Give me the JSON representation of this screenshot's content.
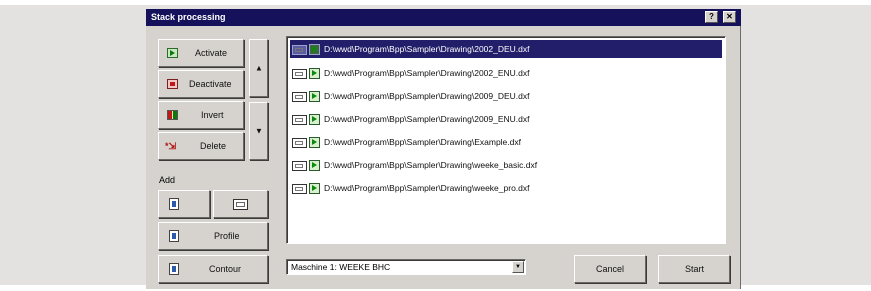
{
  "window": {
    "title": "Stack processing",
    "help_glyph": "?",
    "close_glyph": "✕"
  },
  "buttons": {
    "activate": "Activate",
    "deactivate": "Deactivate",
    "invert": "Invert",
    "delete": "Delete",
    "up_glyph": "▲",
    "down_glyph": "▼",
    "profile": "Profile",
    "contour": "Contour",
    "cancel": "Cancel",
    "start": "Start"
  },
  "add_section": {
    "label": "Add"
  },
  "file_list": {
    "items": [
      {
        "path": "D:\\wwd\\Program\\Bpp\\Sampler\\Drawing\\2002_DEU.dxf",
        "selected": true
      },
      {
        "path": "D:\\wwd\\Program\\Bpp\\Sampler\\Drawing\\2002_ENU.dxf",
        "selected": false
      },
      {
        "path": "D:\\wwd\\Program\\Bpp\\Sampler\\Drawing\\2009_DEU.dxf",
        "selected": false
      },
      {
        "path": "D:\\wwd\\Program\\Bpp\\Sampler\\Drawing\\2009_ENU.dxf",
        "selected": false
      },
      {
        "path": "D:\\wwd\\Program\\Bpp\\Sampler\\Drawing\\Example.dxf",
        "selected": false
      },
      {
        "path": "D:\\wwd\\Program\\Bpp\\Sampler\\Drawing\\weeke_basic.dxf",
        "selected": false
      },
      {
        "path": "D:\\wwd\\Program\\Bpp\\Sampler\\Drawing\\weeke_pro.dxf",
        "selected": false
      }
    ]
  },
  "machine_select": {
    "value": "Maschine 1: WEEKE BHC",
    "arrow_glyph": "▼"
  },
  "colors": {
    "titlebar": "#15125b",
    "selection": "#221e6a",
    "window_face": "#d6d3ce"
  }
}
